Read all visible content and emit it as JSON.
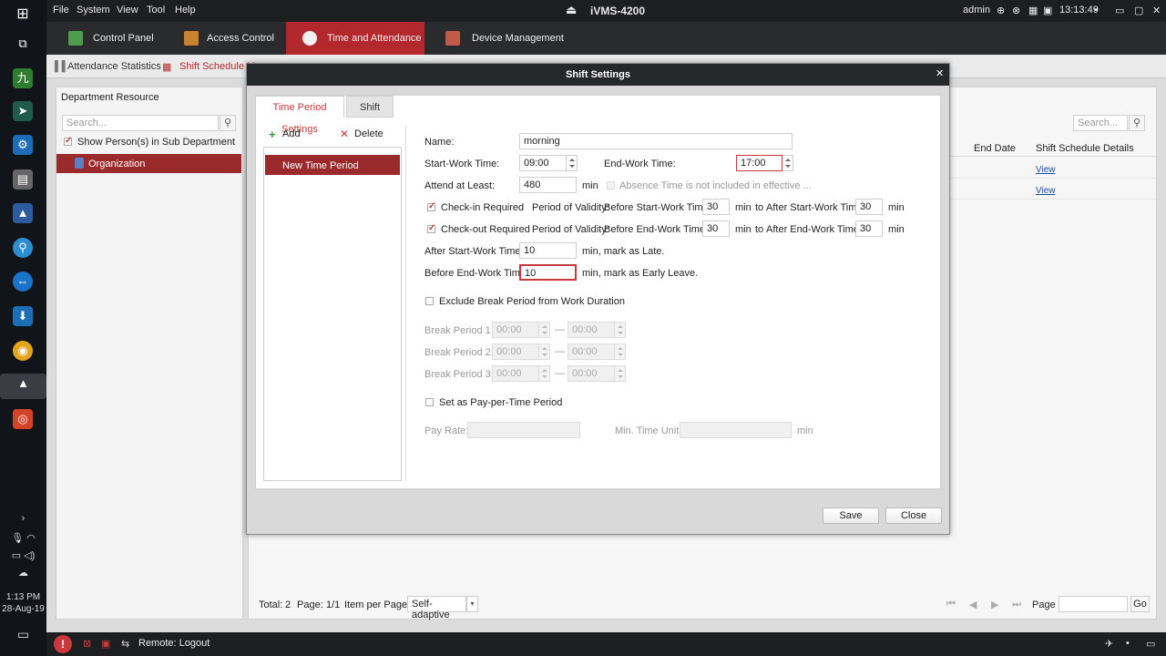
{
  "taskbar": {
    "time": "1:13 PM",
    "date": "28-Aug-19",
    "icons": [
      "windows-icon",
      "task-view-icon",
      "app-green-icon",
      "app-arrow-icon",
      "app-gear-icon",
      "app-disk-icon",
      "app-drive-icon",
      "app-search-icon",
      "teamviewer-icon",
      "app-install-icon",
      "chrome-icon",
      "ivms-icon",
      "app-camera-icon"
    ]
  },
  "menu": {
    "items": [
      "File",
      "System",
      "View",
      "Tool",
      "Help"
    ]
  },
  "app": {
    "title": "iVMS-4200",
    "user": "admin",
    "clock": "13:13:49"
  },
  "nav": {
    "tabs": [
      {
        "label": "Control Panel",
        "color": "#4b9e4b"
      },
      {
        "label": "Access Control",
        "color": "#c9832f"
      },
      {
        "label": "Time and Attendance",
        "color": "#e8e8e8"
      },
      {
        "label": "Device Management",
        "color": "#c25a4a"
      }
    ]
  },
  "subtabs": {
    "attendance_stats": "Attendance Statistics",
    "shift_schedule": "Shift Schedule M"
  },
  "dept": {
    "title": "Department Resource",
    "search_placeholder": "Search...",
    "show_sub": "Show Person(s) in Sub Department",
    "org": "Organization"
  },
  "right": {
    "search_placeholder": "Search...",
    "col_end_date": "End Date",
    "col_details": "Shift Schedule Details",
    "rows": [
      {
        "link": "View"
      },
      {
        "link": "View"
      }
    ],
    "footer": {
      "total_label": "Total:",
      "total": "2",
      "page_label": "Page:",
      "page": "1/1",
      "per_page_label": "Item per Page:",
      "per_page": "Self-adaptive",
      "page_field_label": "Page",
      "go": "Go"
    }
  },
  "dialog": {
    "title": "Shift Settings",
    "tabs": [
      "Time Period Settings",
      "Shift"
    ],
    "add": "Add",
    "delete": "Delete",
    "period_item": "New Time Period",
    "name_label": "Name:",
    "name_value": "morning",
    "start_label": "Start-Work Time:",
    "start_value": "09:00",
    "end_label": "End-Work Time:",
    "end_value": "17:00",
    "attend_label": "Attend at Least:",
    "attend_value": "480",
    "unit_min": "min",
    "absence_label": "Absence Time is not included in effective ...",
    "checkin_label": "Check-in Required",
    "checkout_label": "Check-out Required",
    "validity_label": "Period of Validity:",
    "before_start": "Before Start-Work Time",
    "after_start": "After Start-Work Time",
    "before_end": "Before End-Work Time",
    "after_end": "After End-Work Time",
    "to": "to",
    "v1": "30",
    "v2": "30",
    "v3": "30",
    "v4": "30",
    "late_label": "After Start-Work Time",
    "late_value": "10",
    "late_suffix": "min,  mark as Late.",
    "early_label": "Before End-Work Time",
    "early_value": "10",
    "early_suffix": "min,  mark as Early Leave.",
    "exclude_break": "Exclude Break Period from Work Duration",
    "break_periods": [
      {
        "label": "Break Period  1:",
        "start": "00:00",
        "end": "00:00"
      },
      {
        "label": "Break Period  2:",
        "start": "00:00",
        "end": "00:00"
      },
      {
        "label": "Break Period  3:",
        "start": "00:00",
        "end": "00:00"
      }
    ],
    "dash": "—",
    "pay_per_time": "Set as Pay-per-Time Period",
    "pay_rate": "Pay Rate:",
    "min_unit": "Min. Time Unit:",
    "save": "Save",
    "close": "Close"
  },
  "statusbar": {
    "remote": "Remote: Logout"
  }
}
